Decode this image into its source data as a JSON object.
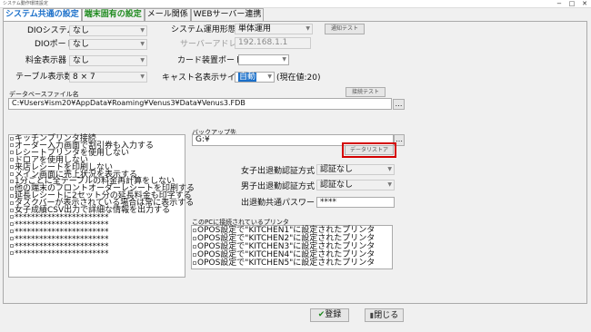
{
  "window": {
    "title": "システム動作環境設定"
  },
  "tabs": [
    {
      "label": "システム共通の設定"
    },
    {
      "label": "端末固有の設定"
    },
    {
      "label": "メール関係"
    },
    {
      "label": "WEBサーバー連携"
    }
  ],
  "fields": {
    "dio_system": {
      "label": "DIOシステム",
      "value": "なし"
    },
    "dio_port": {
      "label": "DIOポート",
      "value": "なし"
    },
    "fare_display": {
      "label": "料金表示器",
      "value": "なし"
    },
    "table_count": {
      "label": "テーブル表示数",
      "value": "8 × 7"
    },
    "system_mode": {
      "label": "システム運用形態",
      "value": "単体運用"
    },
    "notify_test": "通知テスト",
    "server_address": {
      "label": "サーバーアドレス",
      "value": "192.168.1.1"
    },
    "card_port": {
      "label": "カード装置ポート",
      "value": ""
    },
    "cast_size": {
      "label": "キャスト名表示サイズ",
      "value": "自動",
      "suffix": "(現在値:20)"
    },
    "conn_test": "接続テスト",
    "db_file": {
      "label": "データベースファイル名",
      "value": "C:¥Users¥ism20¥AppData¥Roaming¥Venus3¥Data¥Venus3.FDB"
    },
    "backup": {
      "label": "バックアップ先",
      "value": "G:¥"
    },
    "data_restore": "データリストア",
    "female_auth": {
      "label": "女子出退勤認証方式",
      "value": "認証なし"
    },
    "male_auth": {
      "label": "男子出退勤認証方式",
      "value": "認証なし"
    },
    "password": {
      "label": "出退勤共通パスワード",
      "value": "****"
    },
    "printers_label": "このPCに接続されているプリンタ"
  },
  "options": [
    "キッチンプリンタ接続",
    "オーダー入力画面で割引券も入力する",
    "レシートプリンタを使用しない",
    "ドロアを使用しない",
    "来店レシートを印刷しない",
    "メイン画面に売上状況を表示する",
    "1分ごとに全テーブルの料金再計算をしない",
    "他の端末のフロントオーダーレシートを印刷する",
    "延長レシートに2セット分の延長料金も印字する",
    "タスクバーが表示されている場合は常に表示する",
    "女子成績CSV出力で詳細な情報を出力する",
    "***********************",
    "***********************",
    "***********************",
    "***********************",
    "***********************",
    "***********************"
  ],
  "printers": [
    "OPOS設定で\"KITCHEN1\"に設定されたプリンタ",
    "OPOS設定で\"KITCHEN2\"に設定されたプリンタ",
    "OPOS設定で\"KITCHEN3\"に設定されたプリンタ",
    "OPOS設定で\"KITCHEN4\"に設定されたプリンタ",
    "OPOS設定で\"KITCHEN5\"に設定されたプリンタ"
  ],
  "footer": {
    "register": "登録",
    "close": "閉じる"
  },
  "colors": {
    "accent_blue": "#1a6fc9",
    "highlight_red": "#d40000",
    "tab_green": "#1e8a1e"
  }
}
